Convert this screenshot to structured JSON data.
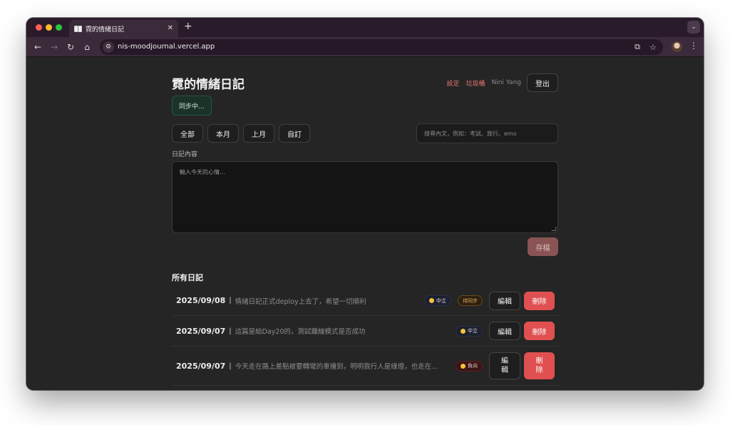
{
  "browser": {
    "tab_title": "霓的情緒日記",
    "url": "nis-moodjournal.vercel.app"
  },
  "header": {
    "title": "霓的情緒日記",
    "settings_label": "設定",
    "trash_label": "垃圾桶",
    "user_name": "Nini Yang",
    "logout_label": "登出"
  },
  "sync_status": "同步中...",
  "filters": [
    "全部",
    "本月",
    "上月",
    "自訂"
  ],
  "search": {
    "placeholder": "搜尋內文，例如：考試、旅行、emo"
  },
  "editor": {
    "label": "日記內容",
    "placeholder": "輸入今天的心情...",
    "save_label": "存檔"
  },
  "list": {
    "title": "所有日記",
    "separator": "|",
    "edit_label": "編輯",
    "delete_label": "刪除",
    "edit_label_wrapped": "編\n輯",
    "delete_label_wrapped": "刪\n除",
    "entries": [
      {
        "date": "2025/09/08",
        "text": "情緒日記正式deploy上去了，希望一切順利",
        "mood": "中立",
        "status": "待同步"
      },
      {
        "date": "2025/09/07",
        "text": "這篇是給Day20的，測試離線模式是否成功",
        "mood": "中立"
      },
      {
        "date": "2025/09/07",
        "text": "今天走在路上差點被要轉彎的車撞到，明明我行人是綠燈，也走在...",
        "mood": "負向"
      }
    ]
  },
  "colors": {
    "accent_red": "#e05050",
    "link_red": "#e57373",
    "sync_green_bg": "#1b3229",
    "pending_orange": "#e0a860"
  }
}
